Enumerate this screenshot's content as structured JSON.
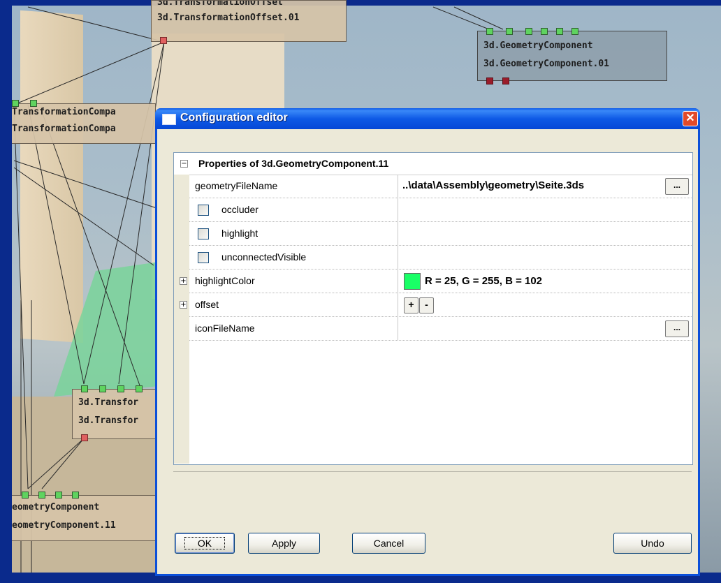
{
  "background_nodes": {
    "top_center": {
      "line1": "3d.TransformationOffset",
      "line2": "3d.TransformationOffset.01"
    },
    "top_right": {
      "line1": "3d.GeometryComponent",
      "line2": "3d.GeometryComponent.01"
    },
    "left_mid": {
      "line1": "TransformationCompa",
      "line2": "TransformationCompa"
    },
    "center_left": {
      "line1": "3d.Transfor",
      "line2": "3d.Transfor"
    },
    "bottom_left": {
      "line1": "eometryComponent",
      "line2": "eometryComponent.11"
    }
  },
  "dialog": {
    "title": "Configuration editor",
    "close_label": "✕",
    "group_title": "Properties of 3d.GeometryComponent.11",
    "properties": [
      {
        "name": "geometryFileName",
        "value": "..\\data\\Assembly\\geometry\\Seite.3ds",
        "button": "..."
      },
      {
        "name": "occluder",
        "checked": false
      },
      {
        "name": "highlight",
        "checked": false
      },
      {
        "name": "unconnectedVisible",
        "checked": false
      },
      {
        "name": "highlightColor",
        "value": "R = 25, G = 255, B = 102",
        "color": "#19ff66"
      },
      {
        "name": "offset",
        "plus": "+",
        "minus": "-"
      },
      {
        "name": "iconFileName",
        "value": "",
        "button": "..."
      }
    ],
    "buttons": {
      "ok": "OK",
      "apply": "Apply",
      "cancel": "Cancel",
      "undo": "Undo"
    }
  },
  "colors": {
    "titlebar": "#0a58e8",
    "port_green": "#5fd35f",
    "port_red": "#e06060",
    "desktop": "#0a2a8c"
  }
}
